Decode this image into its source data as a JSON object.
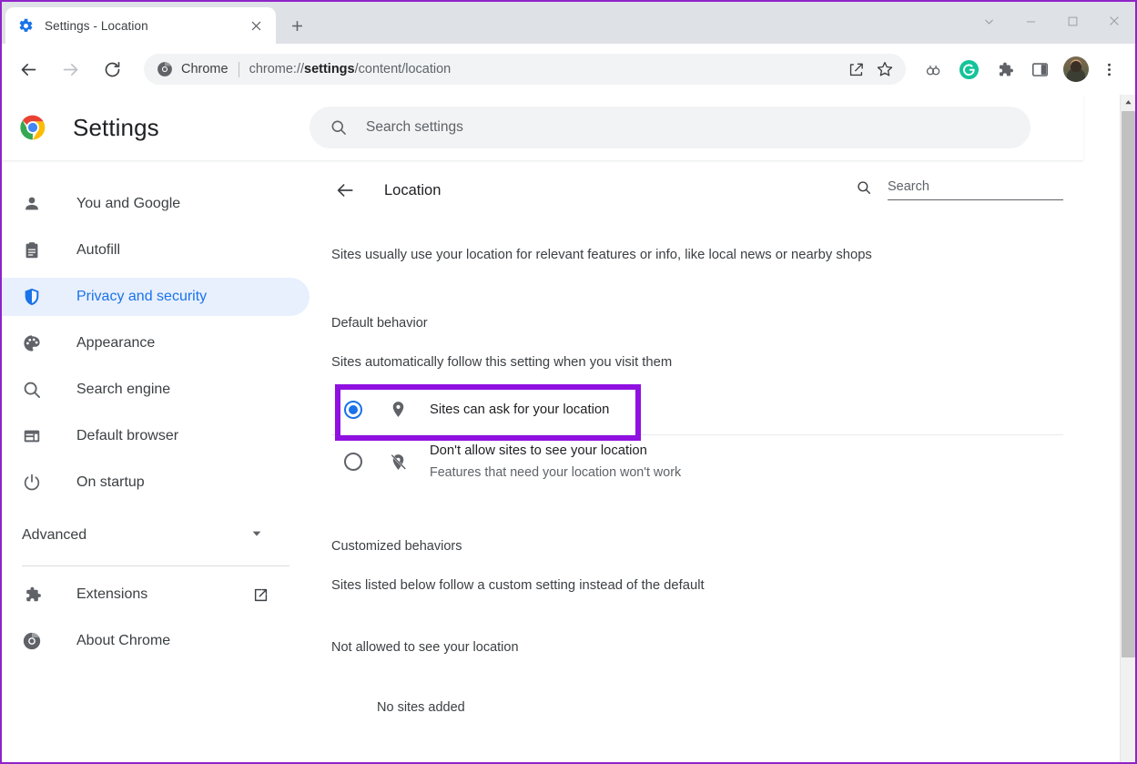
{
  "window": {
    "controls": [
      {
        "name": "minimize",
        "glyph": "—"
      },
      {
        "name": "maximize",
        "glyph": "□"
      },
      {
        "name": "close",
        "glyph": "✕"
      }
    ],
    "tab_search_glyph": "⌄"
  },
  "tabstrip": {
    "tabs": [
      {
        "title": "Settings - Location",
        "favicon": "settings-gear-icon",
        "close_glyph": "✕"
      }
    ],
    "new_tab_glyph": "+",
    "new_tab_name": "new-tab-button"
  },
  "toolbar": {
    "back_name": "back-icon",
    "forward_name": "forward-icon",
    "reload_name": "reload-icon",
    "omnibox": {
      "scheme_icon": "chrome-icon",
      "scheme_label": "Chrome",
      "separator": "|",
      "url_prefix": "chrome://",
      "url_bold": "settings",
      "url_suffix": "/content/location",
      "full_url": "chrome://settings/content/location",
      "share_icon": "share-icon",
      "bookmark_icon": "star-icon"
    },
    "extensions": [
      {
        "name": "link-chain-icon",
        "label": ""
      },
      {
        "name": "grammarly-icon",
        "label": "G",
        "color": "#15c39a"
      },
      {
        "name": "puzzle-extensions-icon",
        "label": ""
      },
      {
        "name": "side-panel-icon",
        "label": ""
      }
    ],
    "avatar_name": "profile-avatar",
    "menu_glyph": "⋮",
    "menu_name": "chrome-menu-button"
  },
  "settings": {
    "brand_title": "Settings",
    "brand_logo": "chrome-logo-icon",
    "search": {
      "placeholder": "Search settings",
      "icon": "search-icon"
    },
    "sidebar": {
      "items": [
        {
          "label": "You and Google",
          "icon": "person-icon",
          "active": false
        },
        {
          "label": "Autofill",
          "icon": "clipboard-icon",
          "active": false
        },
        {
          "label": "Privacy and security",
          "icon": "shield-icon",
          "active": true
        },
        {
          "label": "Appearance",
          "icon": "palette-icon",
          "active": false
        },
        {
          "label": "Search engine",
          "icon": "search-icon",
          "active": false
        },
        {
          "label": "Default browser",
          "icon": "browser-window-icon",
          "active": false
        },
        {
          "label": "On startup",
          "icon": "power-icon",
          "active": false
        }
      ],
      "advanced": {
        "label": "Advanced",
        "chevron": "▾",
        "icon": "chevron-down-icon"
      },
      "footer_items": [
        {
          "label": "Extensions",
          "icon": "puzzle-icon",
          "trailing_icon": "open-in-new-icon"
        },
        {
          "label": "About Chrome",
          "icon": "chrome-icon",
          "trailing_icon": ""
        }
      ]
    },
    "main": {
      "back_icon": "arrow-back-icon",
      "title": "Location",
      "search": {
        "placeholder": "Search",
        "icon": "search-icon"
      },
      "description": "Sites usually use your location for relevant features or info, like local news or nearby shops",
      "default_behavior": {
        "heading": "Default behavior",
        "subheading": "Sites automatically follow this setting when you visit them",
        "options": [
          {
            "label": "Sites can ask for your location",
            "sublabel": "",
            "icon": "location-pin-icon",
            "selected": true,
            "highlighted": true
          },
          {
            "label": "Don't allow sites to see your location",
            "sublabel": "Features that need your location won't work",
            "icon": "location-pin-off-icon",
            "selected": false,
            "highlighted": false
          }
        ]
      },
      "customized_behaviors": {
        "heading": "Customized behaviors",
        "subheading": "Sites listed below follow a custom setting instead of the default",
        "group_label": "Not allowed to see your location",
        "empty_text": "No sites added"
      }
    }
  },
  "colors": {
    "accent_blue": "#1a73e8",
    "active_bg": "#e8f0fe",
    "highlight_purple": "#8f10e0",
    "window_border": "#8e24c9",
    "tabstrip_bg": "#dee1e6",
    "omnibox_bg": "#f1f3f4"
  }
}
